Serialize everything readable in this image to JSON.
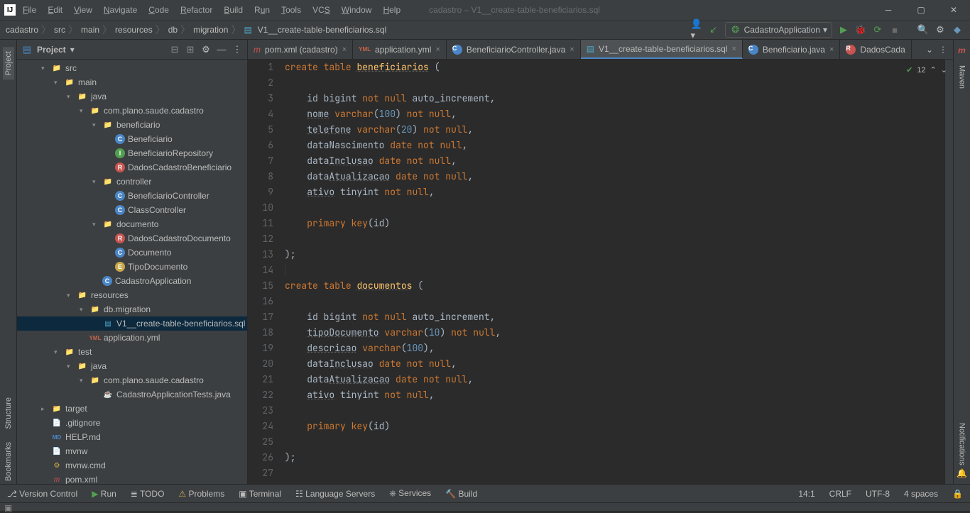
{
  "titlebar": {
    "title": "cadastro – V1__create-table-beneficiarios.sql",
    "menu": [
      "File",
      "Edit",
      "View",
      "Navigate",
      "Code",
      "Refactor",
      "Build",
      "Run",
      "Tools",
      "VCS",
      "Window",
      "Help"
    ]
  },
  "breadcrumb": [
    "cadastro",
    "src",
    "main",
    "resources",
    "db",
    "migration",
    "V1__create-table-beneficiarios.sql"
  ],
  "runConfig": "CadastroApplication",
  "project": {
    "header": "Project",
    "src": "src",
    "main": "main",
    "java": "java",
    "pkg": "com.plano.saude.cadastro",
    "beneficiario": "beneficiario",
    "Beneficiario": "Beneficiario",
    "BeneficiarioRepository": "BeneficiarioRepository",
    "DadosCadastroBeneficiario": "DadosCadastroBeneficiario",
    "controller": "controller",
    "BeneficiarioController": "BeneficiarioController",
    "ClassController": "ClassController",
    "documento": "documento",
    "DadosCadastroDocumento": "DadosCadastroDocumento",
    "Documento": "Documento",
    "TipoDocumento": "TipoDocumento",
    "CadastroApplication": "CadastroApplication",
    "resources": "resources",
    "dbmigration": "db.migration",
    "sqlfile": "V1__create-table-beneficiarios.sql",
    "appyml": "application.yml",
    "test": "test",
    "testjava": "java",
    "testpkg": "com.plano.saude.cadastro",
    "testfile": "CadastroApplicationTests.java",
    "target": "target",
    "gitignore": ".gitignore",
    "help": "HELP.md",
    "mvnw": "mvnw",
    "mvnwcmd": "mvnw.cmd",
    "pomxml": "pom.xml"
  },
  "tabs": [
    {
      "label": "pom.xml (cadastro)",
      "active": false
    },
    {
      "label": "application.yml",
      "active": false
    },
    {
      "label": "BeneficiarioController.java",
      "active": false
    },
    {
      "label": "V1__create-table-beneficiarios.sql",
      "active": true
    },
    {
      "label": "Beneficiario.java",
      "active": false
    },
    {
      "label": "DadosCada",
      "active": false
    }
  ],
  "inspections": "12",
  "code": {
    "lines": [
      1,
      2,
      3,
      4,
      5,
      6,
      7,
      8,
      9,
      10,
      11,
      12,
      13,
      14,
      15,
      16,
      17,
      18,
      19,
      20,
      21,
      22,
      23,
      24,
      25,
      26,
      27
    ]
  },
  "statusL": {
    "vc": "Version Control",
    "run": "Run",
    "todo": "TODO",
    "problems": "Problems",
    "terminal": "Terminal",
    "langserv": "Language Servers",
    "services": "Services",
    "build": "Build"
  },
  "statusR": {
    "pos": "14:1",
    "eol": "CRLF",
    "enc": "UTF-8",
    "indent": "4 spaces"
  },
  "sideL": {
    "project": "Project",
    "bookmarks": "Bookmarks",
    "structure": "Structure"
  },
  "sideR": {
    "maven": "Maven",
    "notifications": "Notifications"
  }
}
